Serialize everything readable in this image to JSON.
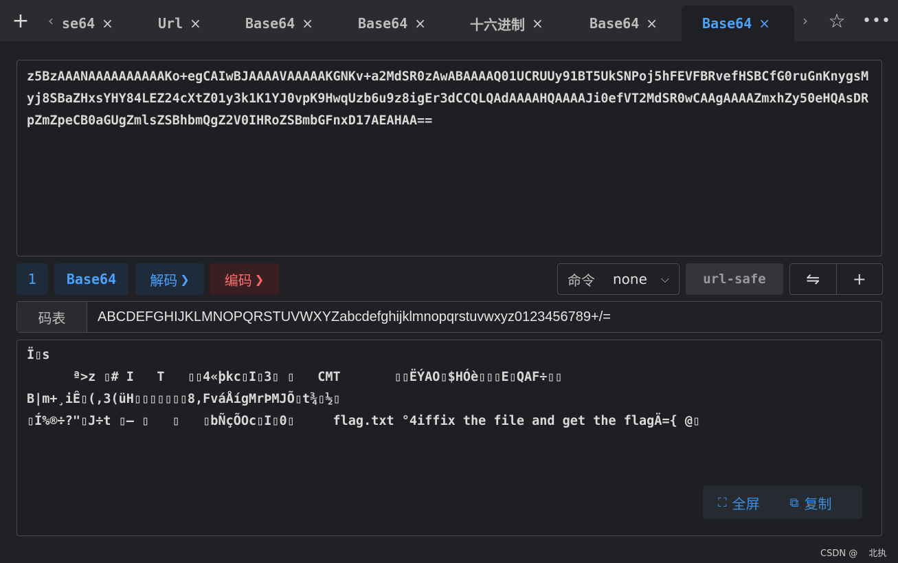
{
  "tabbar": {
    "new_tab_icon": "plus-icon",
    "scroll_left_icon": "chevron-left-icon",
    "scroll_right_icon": "chevron-right-icon",
    "favorite_icon": "star-icon",
    "more_icon": "more-icon",
    "tabs": [
      {
        "label": "se64",
        "active": false
      },
      {
        "label": "Url",
        "active": false
      },
      {
        "label": "Base64",
        "active": false
      },
      {
        "label": "Base64",
        "active": false
      },
      {
        "label": "十六进制",
        "active": false
      },
      {
        "label": "Base64",
        "active": false
      },
      {
        "label": "Base64",
        "active": true
      }
    ],
    "close_glyph": "×",
    "accent_color": "#4aa3ff"
  },
  "input": {
    "value": "z5BzAAANAAAAAAAAAAKo+egCAIwBJAAAAVAAAAAKGNKv+a2MdSR0zAwABAAAAQ01UCRUUy91BT5UkSNPoj5hFEVFBRvefHSBCfG0ruGnKnygsMyj8SBaZHxsYHY84LEZ24cXtZ01y3k1K1YJ0vpK9HwqUzb6u9z8igEr3dCCQLQAdAAAAHQAAAAJi0efVT2MdSR0wCAAgAAAAZmxhZy50eHQAsDRpZmZpeCB0aGUgZmlsZSBhbmQgZ2V0IHRoZSBmbGFnxD17AEAHAA=="
  },
  "toolbar": {
    "count": "1",
    "type": "Base64",
    "decode_label": "解码",
    "encode_label": "编码",
    "command_label": "命令",
    "command_value": "none",
    "url_safe_label": "url-safe",
    "swap_icon": "swap-icon",
    "add_icon": "plus-icon",
    "decode_color": "#4aa3ff",
    "encode_color": "#ff6b6b"
  },
  "code_table": {
    "label": "码表",
    "value": "ABCDEFGHIJKLMNOPQRSTUVWXYZabcdefghijklmnopqrstuvwxyz0123456789+/="
  },
  "output": {
    "lines": [
      "Ï▯s",
      "      ª>z ▯# I   T   ▯▯4«þkc▯I▯3▯ ▯   CMT       ▯▯ËÝAO▯$HÓè▯▯▯E▯QAF÷▯▯",
      "B|m+¸iÊ▯(,3(üH▯▯▯▯▯▯▯8,FváÅígMrÞMJÕ▯t¾▯½▯",
      "▯Í%®÷?\"▯J÷t ▯– ▯   ▯   ▯bÑçÕOc▯I▯0▯     flag.txt °4iffix the file and get the flagÄ={ @▯"
    ],
    "fullscreen_label": "全屏",
    "copy_label": "复制"
  },
  "watermark": {
    "source": "CSDN @",
    "author": "北执"
  }
}
